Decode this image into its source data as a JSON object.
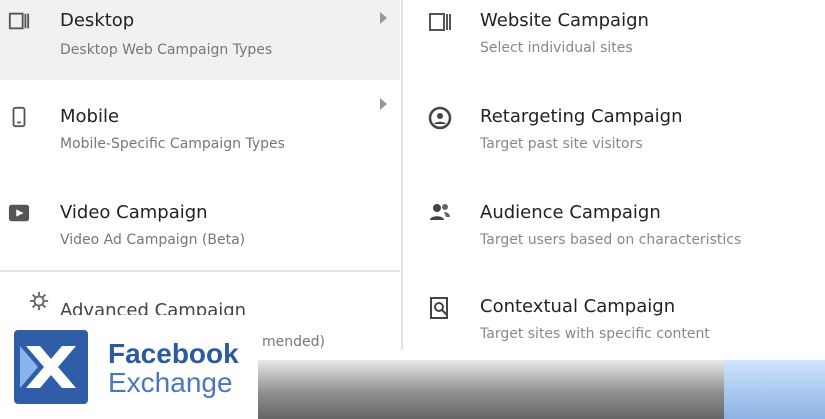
{
  "left_menu": {
    "items": [
      {
        "title": "Desktop",
        "subtitle": "Desktop Web Campaign Types"
      },
      {
        "title": "Mobile",
        "subtitle": "Mobile-Specific Campaign Types"
      },
      {
        "title": "Video Campaign",
        "subtitle": "Video Ad Campaign (Beta)"
      }
    ],
    "partial": {
      "title": "Advanced Campaign",
      "subtitle": "mended)"
    }
  },
  "right_menu": {
    "items": [
      {
        "title": "Website Campaign",
        "subtitle": "Select individual sites"
      },
      {
        "title": "Retargeting Campaign",
        "subtitle": "Target past site visitors"
      },
      {
        "title": "Audience Campaign",
        "subtitle": "Target users based on characteristics"
      },
      {
        "title": "Contextual Campaign",
        "subtitle": "Target sites with specific content"
      }
    ]
  },
  "logo": {
    "line1": "Facebook",
    "line2": "Exchange"
  },
  "colors": {
    "brand_blue": "#2f5da8"
  }
}
